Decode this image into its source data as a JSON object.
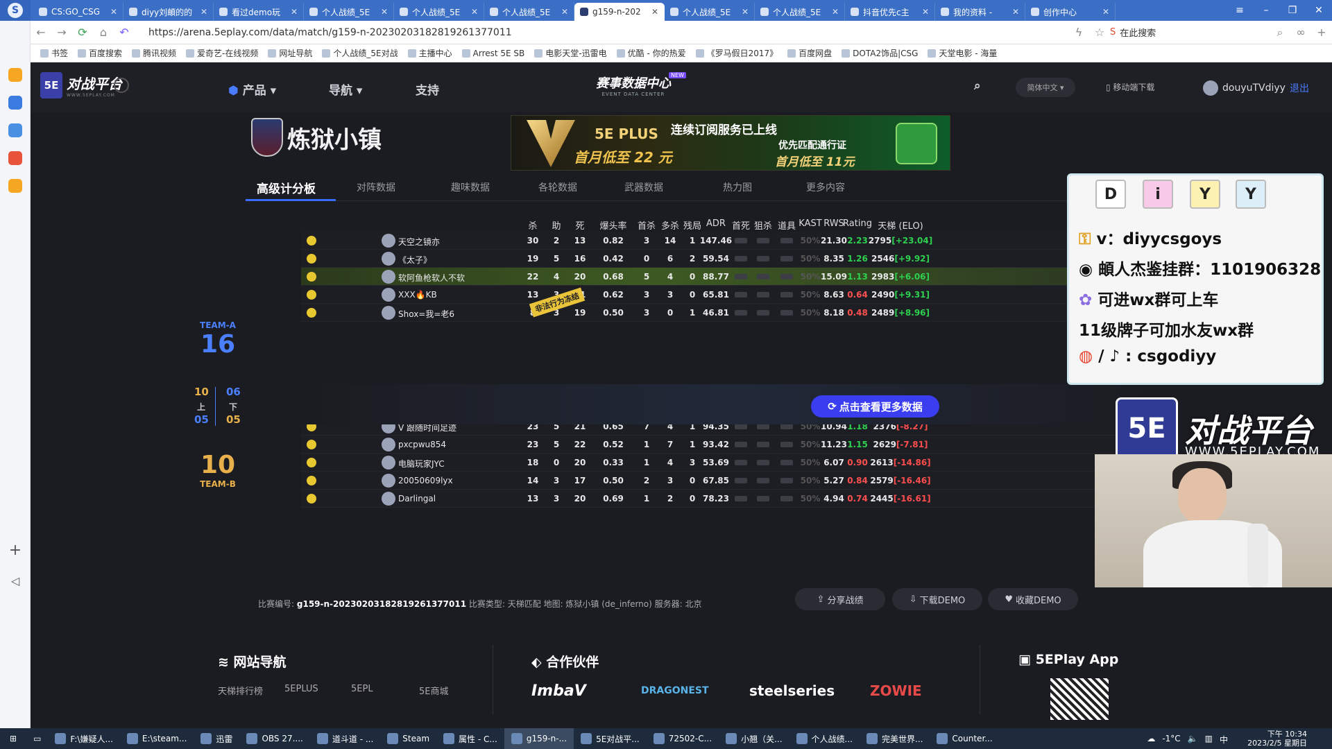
{
  "browser": {
    "tabs": [
      {
        "label": "CS:GO_CSG"
      },
      {
        "label": "diyy刘頔的的"
      },
      {
        "label": "看过demo玩"
      },
      {
        "label": "个人战绩_5E"
      },
      {
        "label": "个人战绩_5E"
      },
      {
        "label": "个人战绩_5E"
      },
      {
        "label": "g159-n-202",
        "active": true
      },
      {
        "label": "个人战绩_5E"
      },
      {
        "label": "个人战绩_5E"
      },
      {
        "label": "抖音优先c主"
      },
      {
        "label": "我的资料 -"
      },
      {
        "label": "创作中心"
      }
    ],
    "url": "https://arena.5eplay.com/data/match/g159-n-20230203182819261377011",
    "search_placeholder": "在此搜索",
    "bookmarks": [
      "书签",
      "百度搜索",
      "腾讯视频",
      "爱奇艺-在线视频",
      "网址导航",
      "个人战绩_5E对战",
      "主播中心",
      "Arrest 5E SB",
      "电影天堂-迅雷电",
      "优酷 - 你的热爱",
      "《罗马假日2017》",
      "百度网盘",
      "DOTA2饰品|CSG",
      "天堂电影 - 海量"
    ]
  },
  "site": {
    "logo_text": "对战平台",
    "logo_sub": "WWW.5EPLAY.COM",
    "nav": {
      "product": "产品",
      "guide": "导航",
      "support": "支持"
    },
    "data_center": {
      "title": "赛事数据中心",
      "sub": "EVENT DATA CENTER",
      "badge": "NEW"
    },
    "lang": "简体中文",
    "mobile": "移动端下载",
    "user": "douyuTVdiyy",
    "logout": "退出"
  },
  "match": {
    "map_name": "炼狱小镇",
    "banner": {
      "plus": "5E PLUS",
      "priv": "PRIVILEGE",
      "price1": "首月低至 22 元",
      "headline": "连续订阅服务已上线",
      "sub": "优先匹配通行证",
      "price2": "首月低至 11元"
    },
    "subtabs": [
      "高级计分板",
      "对阵数据",
      "趣味数据",
      "各轮数据",
      "武器数据",
      "热力图",
      "更多内容"
    ],
    "team_a": {
      "label": "TEAM-A",
      "score": "16"
    },
    "team_b": {
      "label": "TEAM-B",
      "score": "10"
    },
    "halves": {
      "a_first": "10",
      "b_first": "06",
      "a_second": "05",
      "b_second": "05",
      "first_label": "上",
      "second_label": "下"
    },
    "stamp": "非法行为冻结",
    "more_button": "点击查看更多数据",
    "headers": [
      "杀",
      "助",
      "死",
      "爆头率",
      "首杀",
      "多杀",
      "残局",
      "ADR",
      "首死",
      "狙杀",
      "道具",
      "KAST",
      "RWS",
      "Rating",
      "天梯 (ELO)"
    ],
    "team_a_rows": [
      {
        "name": "天空之镜亦",
        "k": "30",
        "a": "2",
        "d": "13",
        "hs": "0.82",
        "fk": "3",
        "mk": "14",
        "cl": "1",
        "adr": "147.46",
        "kast": "50%",
        "rws": "21.30",
        "rating": "2.23",
        "rating_up": true,
        "elo": "2795",
        "delta": "[+23.04]",
        "pos": true
      },
      {
        "name": "《太子》",
        "k": "19",
        "a": "5",
        "d": "16",
        "hs": "0.42",
        "fk": "0",
        "mk": "6",
        "cl": "2",
        "adr": "59.54",
        "kast": "50%",
        "rws": "8.35",
        "rating": "1.26",
        "rating_up": true,
        "elo": "2546",
        "delta": "[+9.92]",
        "pos": true
      },
      {
        "name": "软阿鱼枪软人不软",
        "k": "22",
        "a": "4",
        "d": "20",
        "hs": "0.68",
        "fk": "5",
        "mk": "4",
        "cl": "0",
        "adr": "88.77",
        "kast": "50%",
        "rws": "15.09",
        "rating": "1.13",
        "rating_up": true,
        "elo": "2983",
        "delta": "[+6.06]",
        "pos": true,
        "hl": true
      },
      {
        "name": "XXX🔥KB",
        "k": "13",
        "a": "3",
        "d": "21",
        "hs": "0.62",
        "fk": "3",
        "mk": "3",
        "cl": "0",
        "adr": "65.81",
        "kast": "50%",
        "rws": "8.63",
        "rating": "0.64",
        "rating_up": false,
        "elo": "2490",
        "delta": "[+9.31]",
        "pos": true
      },
      {
        "name": "Shox=我=老6",
        "k": "8",
        "a": "3",
        "d": "19",
        "hs": "0.50",
        "fk": "3",
        "mk": "0",
        "cl": "1",
        "adr": "46.81",
        "kast": "50%",
        "rws": "8.18",
        "rating": "0.48",
        "rating_up": false,
        "elo": "2489",
        "delta": "[+8.96]",
        "pos": true
      }
    ],
    "team_b_rows": [
      {
        "name": "V 跟随时间足迹",
        "k": "23",
        "a": "5",
        "d": "21",
        "hs": "0.65",
        "fk": "7",
        "mk": "4",
        "cl": "1",
        "adr": "94.35",
        "kast": "50%",
        "rws": "10.94",
        "rating": "1.18",
        "rating_up": true,
        "elo": "2376",
        "delta": "[-8.27]",
        "pos": false
      },
      {
        "name": "pxcpwu854",
        "k": "23",
        "a": "5",
        "d": "22",
        "hs": "0.52",
        "fk": "1",
        "mk": "7",
        "cl": "1",
        "adr": "93.42",
        "kast": "50%",
        "rws": "11.23",
        "rating": "1.15",
        "rating_up": true,
        "elo": "2629",
        "delta": "[-7.81]",
        "pos": false
      },
      {
        "name": "电脑玩家JYC",
        "k": "18",
        "a": "0",
        "d": "20",
        "hs": "0.33",
        "fk": "1",
        "mk": "4",
        "cl": "3",
        "adr": "53.69",
        "kast": "50%",
        "rws": "6.07",
        "rating": "0.90",
        "rating_up": false,
        "elo": "2613",
        "delta": "[-14.86]",
        "pos": false
      },
      {
        "name": "20050609lyx",
        "k": "14",
        "a": "3",
        "d": "17",
        "hs": "0.50",
        "fk": "2",
        "mk": "3",
        "cl": "0",
        "adr": "67.85",
        "kast": "50%",
        "rws": "5.27",
        "rating": "0.84",
        "rating_up": false,
        "elo": "2579",
        "delta": "[-16.46]",
        "pos": false
      },
      {
        "name": "Darlingal",
        "k": "13",
        "a": "3",
        "d": "20",
        "hs": "0.69",
        "fk": "1",
        "mk": "2",
        "cl": "0",
        "adr": "78.23",
        "kast": "50%",
        "rws": "4.94",
        "rating": "0.74",
        "rating_up": false,
        "elo": "2445",
        "delta": "[-16.61]",
        "pos": false
      }
    ],
    "meta_prefix": "比赛编号:",
    "match_id": "g159-n-20230203182819261377011",
    "meta_rest": "比赛类型: 天梯匹配 地图: 炼狱小镇 (de_inferno) 服务器: 北京",
    "buttons": {
      "share": "分享战绩",
      "download": "下载DEMO",
      "collect": "收藏DEMO"
    }
  },
  "footer": {
    "nav_title": "网站导航",
    "partner_title": "合作伙伴",
    "app_title": "5EPlay App",
    "links": [
      "天梯排行榜",
      "5EPLUS",
      "5EPL",
      "5E商城"
    ],
    "partners": [
      "ImbaV",
      "DRAGONEST",
      "steelseries",
      "ZOWIE"
    ]
  },
  "overlay": {
    "tags": [
      "D",
      "i",
      "Y",
      "Y"
    ],
    "lines": [
      "v：diyycsgoys",
      "頔人杰鉴挂群：1101906328",
      "可进wx群可上车",
      "11级牌子可加水友wx群",
      "/ ♪ : csgodiyy"
    ],
    "watermark": "对战平台",
    "watermark_url": "WWW.5EPLAY.COM"
  },
  "taskbar": {
    "items": [
      "F:\\嫌疑人...",
      "E:\\steam...",
      "迅雷",
      "OBS 27....",
      "道斗道 - ...",
      "Steam",
      "属性 - C...",
      "g159-n-...",
      "5E对战平...",
      "72502-C...",
      "小翘（关...",
      "个人战绩...",
      "完美世界...",
      "Counter..."
    ],
    "temp": "-1°C",
    "ime": "中",
    "time": "下午 10:34",
    "date": "2023/2/5 星期日"
  },
  "colors": {
    "accent": "#3a6cff",
    "positive": "#2ed14f",
    "negative": "#ff4d4d",
    "team_a": "#4a80ff",
    "team_b": "#e8b04a"
  }
}
